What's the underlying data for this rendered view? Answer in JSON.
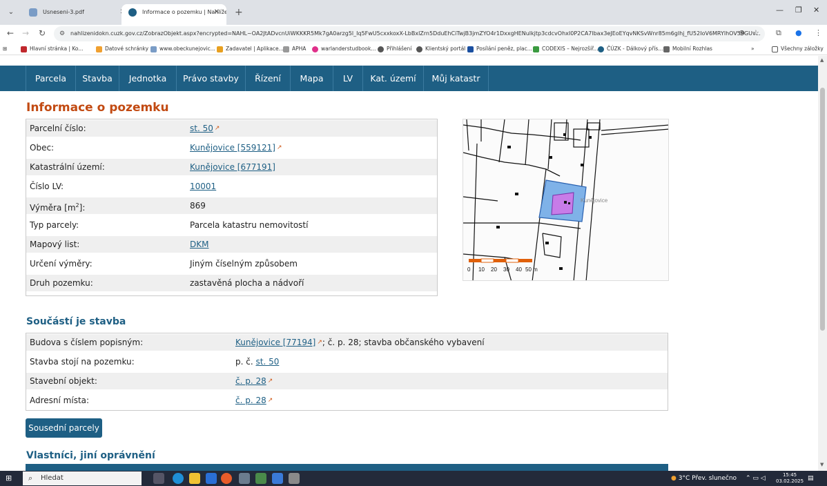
{
  "browser": {
    "tabs": [
      {
        "title": "Usneseni-3.pdf"
      },
      {
        "title": "Informace o pozemku | Nahlíže"
      }
    ],
    "url": "nahlizenidokn.cuzk.gov.cz/ZobrazObjekt.aspx?encrypted=NAHL~OA2JtADvcnUiWKKKR5Mk7gA0arzg5l_Iq5FwU5cxxkoxX-LbBxlZrn5DduEhCiTwjB3jmZYO4r1DxxgHENulkjtp3cdcvOhxI0P2CA7lbax3eJEoEYqvNKSvWnr85m6glhj_fU52IoV6MRYlhOV59GUv...",
    "bookmarks": [
      "Hlavní stránka | Ko...",
      "Datové schránky",
      "www.obeckunejovic...",
      "Zadavatel | Aplikace...",
      "APHA",
      "warlanderstudbook...",
      "Přihlášení",
      "Klientský portál",
      "Posílání peněz, plac...",
      "CODEXIS – Nejrozšíř...",
      "ČÚZK - Dálkový přís...",
      "Mobilní Rozhlas"
    ],
    "all_bookmarks": "Všechny záložky",
    "more_bookmarks": "»"
  },
  "nav": {
    "items": [
      "Parcela",
      "Stavba",
      "Jednotka",
      "Právo stavby",
      "Řízení",
      "Mapa",
      "LV",
      "Kat. území",
      "Můj katastr"
    ]
  },
  "parcel": {
    "title": "Informace o pozemku",
    "rows": [
      {
        "label": "Parcelní číslo:",
        "value": "st. 50",
        "link": true,
        "external": true
      },
      {
        "label": "Obec:",
        "value": "Kunějovice [559121]",
        "link": true,
        "external": true
      },
      {
        "label": "Katastrální území:",
        "value": "Kunějovice [677191]",
        "link": true,
        "external": false
      },
      {
        "label": "Číslo LV:",
        "value": "10001",
        "link": true,
        "external": false
      },
      {
        "label_prefix": "Výměra [m",
        "label_sup": "2",
        "label_suffix": "]:",
        "value": "869",
        "link": false
      },
      {
        "label": "Typ parcely:",
        "value": "Parcela katastru nemovitostí",
        "link": false
      },
      {
        "label": "Mapový list:",
        "value": "DKM",
        "link": true,
        "external": false
      },
      {
        "label": "Určení výměry:",
        "value": "Jiným číselným způsobem",
        "link": false
      },
      {
        "label": "Druh pozemku:",
        "value": "zastavěná plocha a nádvoří",
        "link": false
      }
    ]
  },
  "map": {
    "scale_labels": [
      "0",
      "10",
      "20",
      "30",
      "40",
      "50 m"
    ],
    "watermark": "Kunějovice"
  },
  "building": {
    "title": "Součástí je stavba",
    "rows": [
      {
        "label": "Budova s číslem popisným:",
        "link_text": "Kunějovice [77194]",
        "after": "; č. p. 28; stavba občanského vybavení"
      },
      {
        "label": "Stavba stojí na pozemku:",
        "prefix": "p. č. ",
        "link_text": "st. 50"
      },
      {
        "label": "Stavební objekt:",
        "link_text": "č. p. 28"
      },
      {
        "label": "Adresní místa:",
        "link_text": "č. p. 28"
      }
    ]
  },
  "neighbors_button": "Sousední parcely",
  "owners_title": "Vlastníci, jiní oprávnění",
  "taskbar": {
    "search_placeholder": "Hledat",
    "weather": "3°C  Přev. slunečno",
    "time": "15:45",
    "date": "03.02.2025"
  },
  "colors": {
    "nav_bg": "#1e5f84",
    "title": "#c24a12",
    "section": "#1e5f84",
    "parcel_highlight": "#7fb2e8",
    "building_fill": "#c77ce8"
  }
}
